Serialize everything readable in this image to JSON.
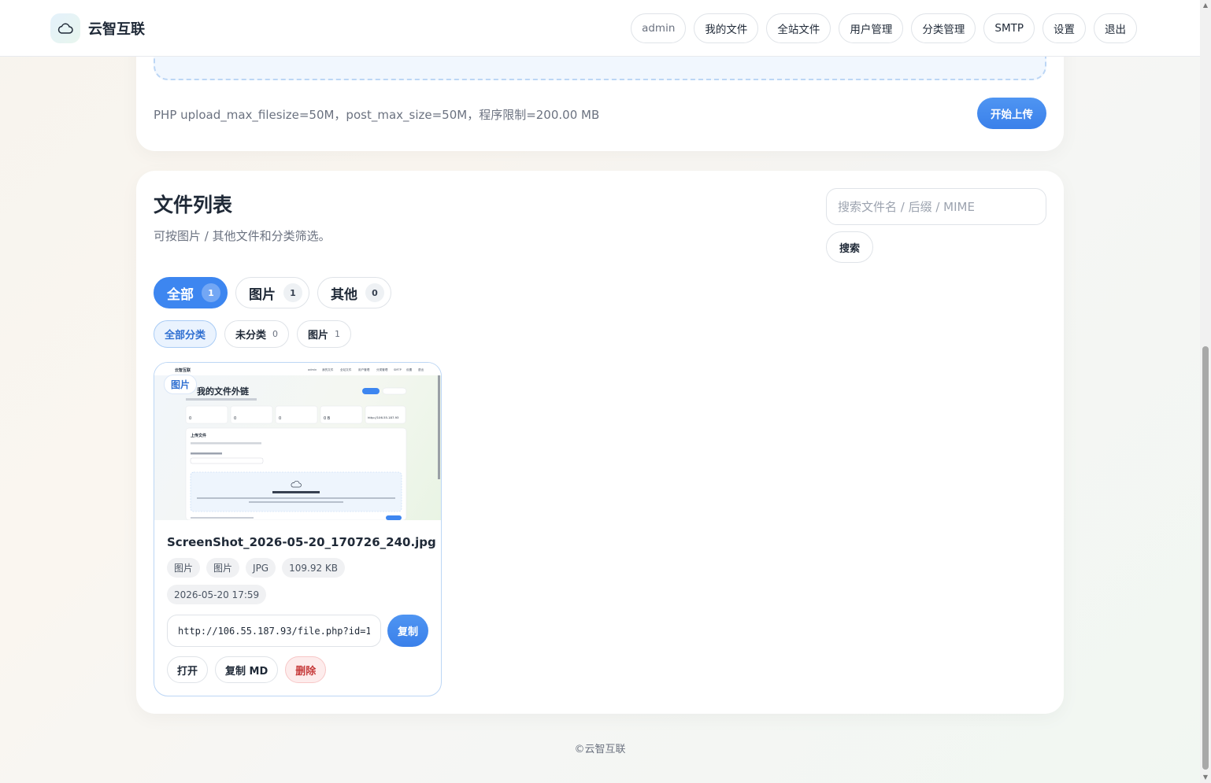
{
  "brand": {
    "name": "云智互联",
    "logo_icon": "cloud-icon"
  },
  "nav": {
    "items": [
      {
        "label": "admin"
      },
      {
        "label": "我的文件"
      },
      {
        "label": "全站文件"
      },
      {
        "label": "用户管理"
      },
      {
        "label": "分类管理"
      },
      {
        "label": "SMTP"
      },
      {
        "label": "设置"
      },
      {
        "label": "退出"
      }
    ]
  },
  "upload": {
    "limit_text": "PHP upload_max_filesize=50M，post_max_size=50M，程序限制=200.00 MB",
    "start_label": "开始上传"
  },
  "files": {
    "title": "文件列表",
    "subtitle": "可按图片 / 其他文件和分类筛选。",
    "search_placeholder": "搜索文件名 / 后缀 / MIME",
    "search_label": "搜索",
    "type_tabs": [
      {
        "label": "全部",
        "count": "1"
      },
      {
        "label": "图片",
        "count": "1"
      },
      {
        "label": "其他",
        "count": "0"
      }
    ],
    "category_tabs": [
      {
        "label": "全部分类",
        "count": ""
      },
      {
        "label": "未分类",
        "count": "0"
      },
      {
        "label": "图片",
        "count": "1"
      }
    ],
    "items": [
      {
        "badge": "图片",
        "name": "ScreenShot_2026-05-20_170726_240.jpg",
        "meta": [
          "图片",
          "图片",
          "JPG",
          "109.92 KB"
        ],
        "date": "2026-05-20 17:59",
        "link": "http://106.55.187.93/file.php?id=1",
        "copy_label": "复制",
        "open_label": "打开",
        "copy_md_label": "复制 MD",
        "delete_label": "删除",
        "thumbnail": {
          "brand": "云智互联",
          "title": "我的文件外链",
          "section_title": "上传文件",
          "nav_items": [
            "admin",
            "我的文件",
            "全站文件",
            "用户管理",
            "分类管理",
            "SMTP",
            "设置",
            "退出"
          ],
          "stat_values": [
            "0",
            "0",
            "0",
            "0 B",
            "http://106.55.187.93"
          ]
        }
      }
    ]
  },
  "footer": {
    "text": "©云智互联"
  },
  "colors": {
    "accent": "#3d86f0",
    "danger": "#c63a3a",
    "active_category_bg": "#eaf3fe"
  }
}
